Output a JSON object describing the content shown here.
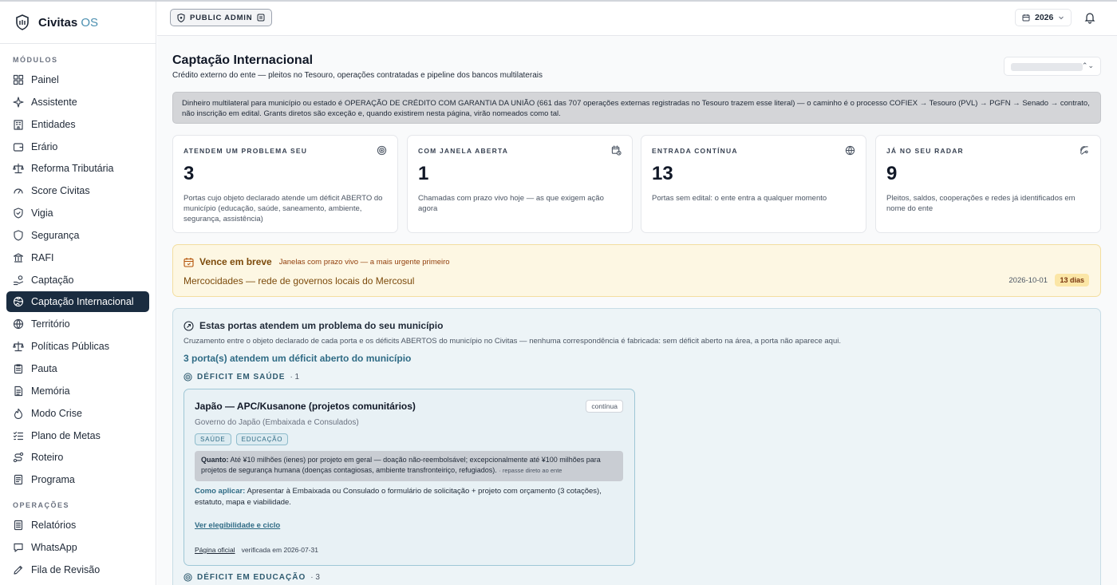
{
  "app": {
    "brand_main": "Civitas",
    "brand_accent": "OS"
  },
  "sidebar": {
    "section_modules": "MÓDULOS",
    "modules": [
      {
        "label": "Painel",
        "icon": "grid-icon"
      },
      {
        "label": "Assistente",
        "icon": "sparkle-icon"
      },
      {
        "label": "Entidades",
        "icon": "building-icon"
      },
      {
        "label": "Erário",
        "icon": "wallet-icon"
      },
      {
        "label": "Reforma Tributária",
        "icon": "scale-icon"
      },
      {
        "label": "Score Civitas",
        "icon": "gauge-icon"
      },
      {
        "label": "Vigia",
        "icon": "shield-check-icon"
      },
      {
        "label": "Segurança",
        "icon": "shield-icon"
      },
      {
        "label": "RAFI",
        "icon": "bank-icon"
      },
      {
        "label": "Captação",
        "icon": "hand-coins-icon"
      },
      {
        "label": "Captação Internacional",
        "icon": "globe-hand-icon",
        "active": true
      },
      {
        "label": "Território",
        "icon": "globe-icon"
      },
      {
        "label": "Políticas Públicas",
        "icon": "scale-icon"
      },
      {
        "label": "Pauta",
        "icon": "clipboard-icon"
      },
      {
        "label": "Memória",
        "icon": "document-icon"
      },
      {
        "label": "Modo Crise",
        "icon": "flame-icon"
      },
      {
        "label": "Plano de Metas",
        "icon": "list-check-icon"
      },
      {
        "label": "Roteiro",
        "icon": "route-icon"
      },
      {
        "label": "Programa",
        "icon": "file-text-icon"
      }
    ],
    "section_operations": "OPERAÇÕES",
    "operations": [
      {
        "label": "Relatórios",
        "icon": "report-icon"
      },
      {
        "label": "WhatsApp",
        "icon": "message-icon"
      },
      {
        "label": "Fila de Revisão",
        "icon": "pen-icon"
      }
    ]
  },
  "topbar": {
    "role": "PUBLIC ADMIN",
    "year": "2026"
  },
  "page": {
    "title": "Captação Internacional",
    "subtitle": "Crédito externo do ente — pleitos no Tesouro, operações contratadas e pipeline dos bancos multilaterais",
    "notice": "Dinheiro multilateral para município ou estado é OPERAÇÃO DE CRÉDITO COM GARANTIA DA UNIÃO (661 das 707 operações externas registradas no Tesouro trazem esse literal) — o caminho é o processo COFIEX → Tesouro (PVL) → PGFN → Senado → contrato, não inscrição em edital. Grants diretos são exceção e, quando existirem nesta página, virão nomeados como tal."
  },
  "kpis": [
    {
      "label": "ATENDEM UM PROBLEMA SEU",
      "value": "3",
      "desc": "Portas cujo objeto declarado atende um déficit ABERTO do município (educação, saúde, saneamento, ambiente, segurança, assistência)",
      "icon": "target-icon"
    },
    {
      "label": "COM JANELA ABERTA",
      "value": "1",
      "desc": "Chamadas com prazo vivo hoje — as que exigem ação agora",
      "icon": "calendar-clock-icon"
    },
    {
      "label": "ENTRADA CONTÍNUA",
      "value": "13",
      "desc": "Portas sem edital: o ente entra a qualquer momento",
      "icon": "globe-icon"
    },
    {
      "label": "JÁ NO SEU RADAR",
      "value": "9",
      "desc": "Pleitos, saldos, cooperações e redes já identificados em nome do ente",
      "icon": "radar-icon"
    }
  ],
  "due_soon": {
    "title": "Vence em breve",
    "subtitle": "Janelas com prazo vivo — a mais urgente primeiro",
    "item": "Mercocidades — rede de governos locais do Mercosul",
    "date": "2026-10-01",
    "badge": "13 dias"
  },
  "match": {
    "title": "Estas portas atendem um problema do seu município",
    "desc": "Cruzamento entre o objeto declarado de cada porta e os déficits ABERTOS do município no Civitas — nenhuma correspondência é fabricada: sem déficit aberto na área, a porta não aparece aqui.",
    "count": "3 porta(s) atendem um déficit aberto do município",
    "groups": [
      {
        "label": "DÉFICIT EM SAÚDE",
        "count": "· 1"
      },
      {
        "label": "DÉFICIT EM EDUCAÇÃO",
        "count": "· 3"
      }
    ],
    "card": {
      "title": "Japão — APC/Kusanone (projetos comunitários)",
      "tag": "contínua",
      "org": "Governo do Japão (Embaixada e Consulados)",
      "chips": [
        "SAÚDE",
        "EDUCAÇÃO"
      ],
      "quanto_label": "Quanto:",
      "quanto_text": "Até ¥10 milhões (ienes) por projeto em geral — doação não-reembolsável; excepcionalmente até ¥100 milhões para projetos de segurança humana (doenças contagiosas, ambiente transfronteiriço, refugiados).",
      "quanto_note": "· repasse direto ao ente",
      "aplicar_label": "Como aplicar:",
      "aplicar_text": "Apresentar à Embaixada ou Consulado o formulário de solicitação + projeto com orçamento (3 cotações), estatuto, mapa e viabilidade.",
      "elig_link": "Ver elegibilidade e ciclo",
      "official_link": "Página oficial",
      "verified": "verificada em 2026-07-31"
    }
  }
}
